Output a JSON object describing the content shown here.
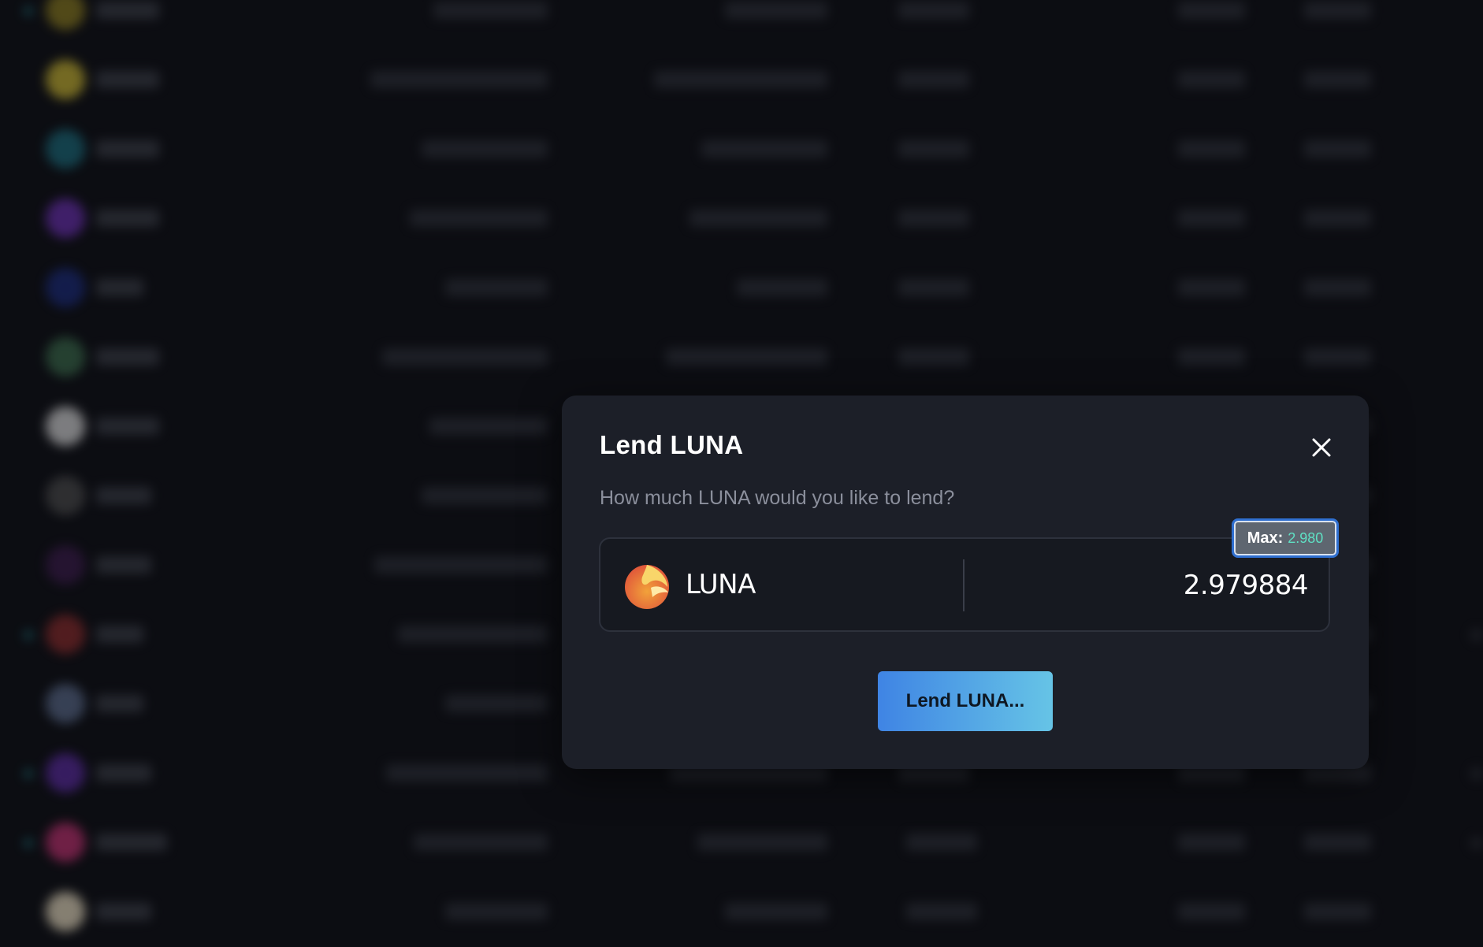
{
  "modal": {
    "title": "Lend LUNA",
    "subtitle": "How much LUNA would you like to lend?",
    "token_symbol": "LUNA",
    "amount_value": "2.979884",
    "max_label": "Max:",
    "max_value": "2.980",
    "submit_label": "Lend LUNA...",
    "close_icon": "close-icon",
    "token_icon": "luna-icon"
  },
  "background_table": {
    "avatar_colors": [
      "#8a7a1e",
      "#c9b531",
      "#1a6a7a",
      "#6a2fb0",
      "#1a2a7a",
      "#3a6a4a",
      "#d8d8d8",
      "#4a4a4a",
      "#3a1a4a",
      "#8a2a2a",
      "#5a6a8a",
      "#5a2aa0",
      "#c03070",
      "#e8dcc0"
    ]
  }
}
